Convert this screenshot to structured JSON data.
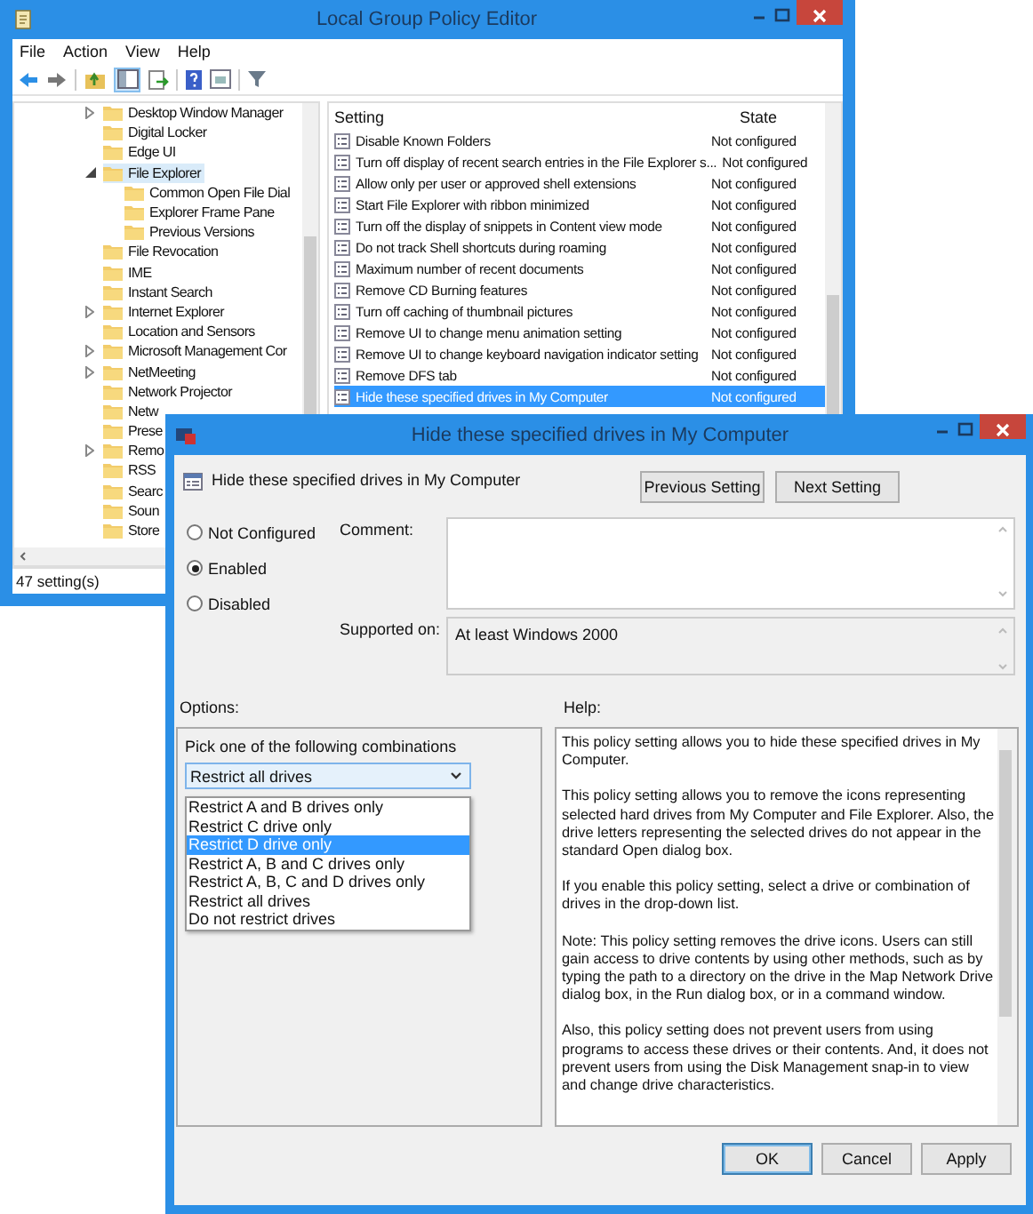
{
  "main_window": {
    "title": "Local Group Policy Editor",
    "menu": [
      "File",
      "Action",
      "View",
      "Help"
    ],
    "console_tree_shown": true,
    "tree": [
      {
        "label": "Desktop Window Manager",
        "expanded": false,
        "selected": false
      },
      {
        "label": "Digital Locker",
        "selected": false
      },
      {
        "label": "Edge UI",
        "selected": false
      },
      {
        "label": "File Explorer",
        "expanded": true,
        "selected": true,
        "children": [
          {
            "label": "Common Open File Dial",
            "selected": false
          },
          {
            "label": "Explorer Frame Pane",
            "selected": false
          },
          {
            "label": "Previous Versions",
            "selected": false
          }
        ]
      },
      {
        "label": "File Revocation",
        "selected": false
      },
      {
        "label": "IME",
        "selected": false
      },
      {
        "label": "Instant Search",
        "selected": false
      },
      {
        "label": "Internet Explorer",
        "expanded": false,
        "selected": false
      },
      {
        "label": "Location and Sensors",
        "selected": false
      },
      {
        "label": "Microsoft Management Cor",
        "expanded": false,
        "selected": false
      },
      {
        "label": "NetMeeting",
        "expanded": false,
        "selected": false
      },
      {
        "label": "Network Projector",
        "selected": false
      },
      {
        "label": "Netw",
        "selected": false
      },
      {
        "label": "Prese",
        "selected": false
      },
      {
        "label": "Remo",
        "expanded": false,
        "selected": false
      },
      {
        "label": "RSS",
        "selected": false
      },
      {
        "label": "Searc",
        "selected": false
      },
      {
        "label": "Soun",
        "selected": false
      },
      {
        "label": "Store",
        "selected": false
      }
    ],
    "list": {
      "columns": [
        "Setting",
        "State"
      ],
      "rows": [
        {
          "setting": "Disable Known Folders",
          "state": "Not configured",
          "selected": false
        },
        {
          "setting": "Turn off display of recent search entries in the File Explorer s...",
          "state": "Not configured",
          "selected": false
        },
        {
          "setting": "Allow only per user or approved shell extensions",
          "state": "Not configured",
          "selected": false
        },
        {
          "setting": "Start File Explorer with ribbon minimized",
          "state": "Not configured",
          "selected": false
        },
        {
          "setting": "Turn off the display of snippets in Content view mode",
          "state": "Not configured",
          "selected": false
        },
        {
          "setting": "Do not track Shell shortcuts during roaming",
          "state": "Not configured",
          "selected": false
        },
        {
          "setting": "Maximum number of recent documents",
          "state": "Not configured",
          "selected": false
        },
        {
          "setting": "Remove CD Burning features",
          "state": "Not configured",
          "selected": false
        },
        {
          "setting": "Turn off caching of thumbnail pictures",
          "state": "Not configured",
          "selected": false
        },
        {
          "setting": "Remove UI to change menu animation setting",
          "state": "Not configured",
          "selected": false
        },
        {
          "setting": "Remove UI to change keyboard navigation indicator setting",
          "state": "Not configured",
          "selected": false
        },
        {
          "setting": "Remove DFS tab",
          "state": "Not configured",
          "selected": false
        },
        {
          "setting": "Hide these specified drives in My Computer",
          "state": "Not configured",
          "selected": true
        }
      ]
    },
    "status_bar": "47 setting(s)"
  },
  "dialog": {
    "title": "Hide these specified drives in My Computer",
    "heading": "Hide these specified drives in My Computer",
    "nav_buttons": [
      "Previous Setting",
      "Next Setting"
    ],
    "radios": [
      {
        "label": "Not Configured",
        "selected": false
      },
      {
        "label": "Enabled",
        "selected": true
      },
      {
        "label": "Disabled",
        "selected": false
      }
    ],
    "comment_label": "Comment:",
    "supported_label": "Supported on:",
    "supported_value": "At least Windows 2000",
    "options_label": "Options:",
    "help_label": "Help:",
    "combo_label": "Pick one of the following combinations",
    "combo_value": "Restrict all drives",
    "combo_options": [
      {
        "label": "Restrict A and B drives only",
        "selected": false
      },
      {
        "label": "Restrict C drive only",
        "selected": false
      },
      {
        "label": "Restrict D drive only",
        "selected": true
      },
      {
        "label": "Restrict A, B and C drives only",
        "selected": false
      },
      {
        "label": "Restrict A, B, C and D drives only",
        "selected": false
      },
      {
        "label": "Restrict all drives",
        "selected": false
      },
      {
        "label": "Do not restrict drives",
        "selected": false
      }
    ],
    "help": [
      "This policy setting allows you to hide these specified drives in My Computer.",
      "This policy setting allows you to remove the icons representing selected hard drives from My Computer and File Explorer. Also, the drive letters representing the selected drives do not appear in the standard Open dialog box.",
      "If you enable this policy setting, select a drive or combination of drives in the drop-down list.",
      "Note: This policy setting removes the drive icons. Users can still gain access to drive contents by using other methods, such as by typing the path to a directory on the drive in the Map Network Drive dialog box, in the Run dialog box, or in a command window.",
      "Also, this policy setting does not prevent users from using programs to access these drives or their contents. And, it does not prevent users from using the Disk Management snap-in to view and change drive characteristics."
    ],
    "buttons": [
      {
        "label": "OK",
        "default": true
      },
      {
        "label": "Cancel",
        "default": false
      },
      {
        "label": "Apply",
        "default": false
      }
    ]
  }
}
